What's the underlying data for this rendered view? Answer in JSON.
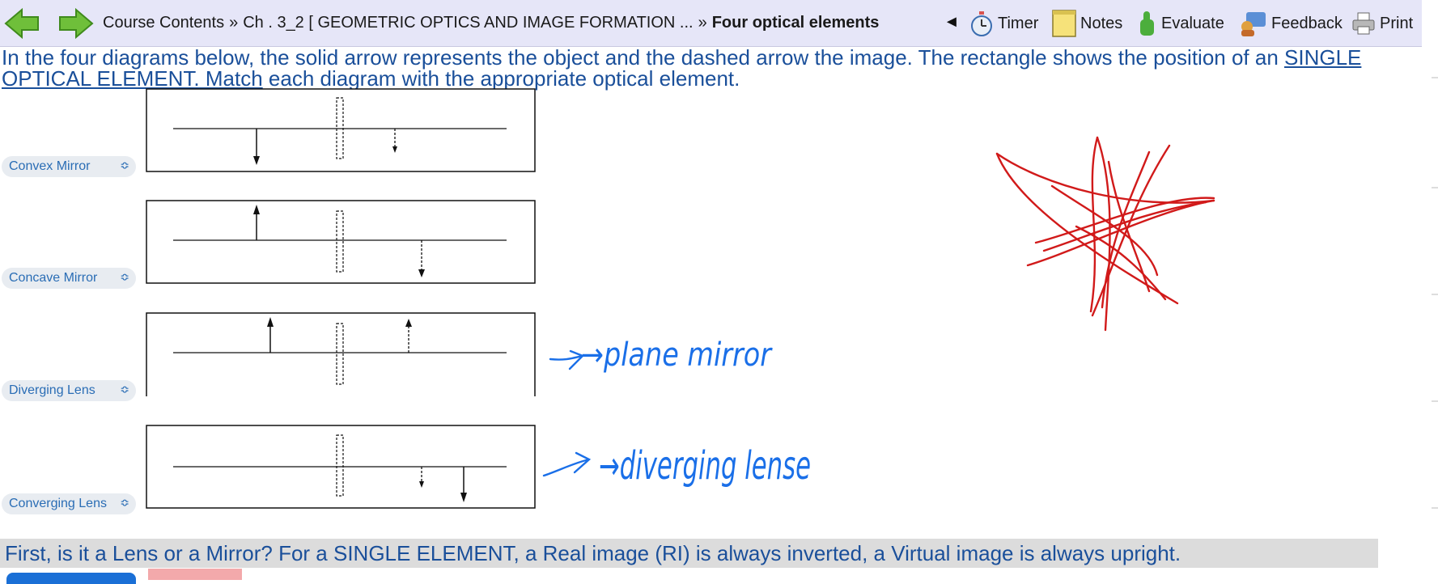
{
  "toolbar": {
    "breadcrumb": {
      "course": "Course Contents",
      "separator": "»",
      "chapter": "Ch . 3_2 [ GEOMETRIC OPTICS AND IMAGE FORMATION ...",
      "current": "Four optical elements"
    },
    "tools": {
      "collapse": "◄",
      "timer": "Timer",
      "notes": "Notes",
      "evaluate": "Evaluate",
      "feedback": "Feedback",
      "print": "Print"
    }
  },
  "question": {
    "part1": "In the four diagrams below, the solid arrow represents the object and the dashed arrow the image. The rectangle shows the position of an ",
    "emphasis": "SINGLE OPTICAL ELEMENT. Match",
    "part2": " each diagram with the appropriate optical element."
  },
  "answers": [
    {
      "selected": "Convex Mirror"
    },
    {
      "selected": "Concave Mirror"
    },
    {
      "selected": "Diverging Lens"
    },
    {
      "selected": "Converging Lens"
    }
  ],
  "handwriting": {
    "note_1": "→plane mirror",
    "note_2": "→diverging lense"
  },
  "hint": "First, is it a Lens or a Mirror? For a SINGLE ELEMENT, a Real image (RI) is always inverted, a Virtual image is always upright.",
  "colors": {
    "toolbar_bg": "#e6e6f8",
    "question_text": "#1a4f9a",
    "select_text": "#2a6db5",
    "ink_blue": "#1a6fe8",
    "ink_red": "#d11a1a",
    "hint_bg": "#dcdcdc"
  },
  "icons": [
    "back-arrow-icon",
    "forward-arrow-icon",
    "stopwatch-icon",
    "notepad-icon",
    "thumbs-up-icon",
    "feedback-icon",
    "printer-icon",
    "chevron-updown-icon"
  ]
}
